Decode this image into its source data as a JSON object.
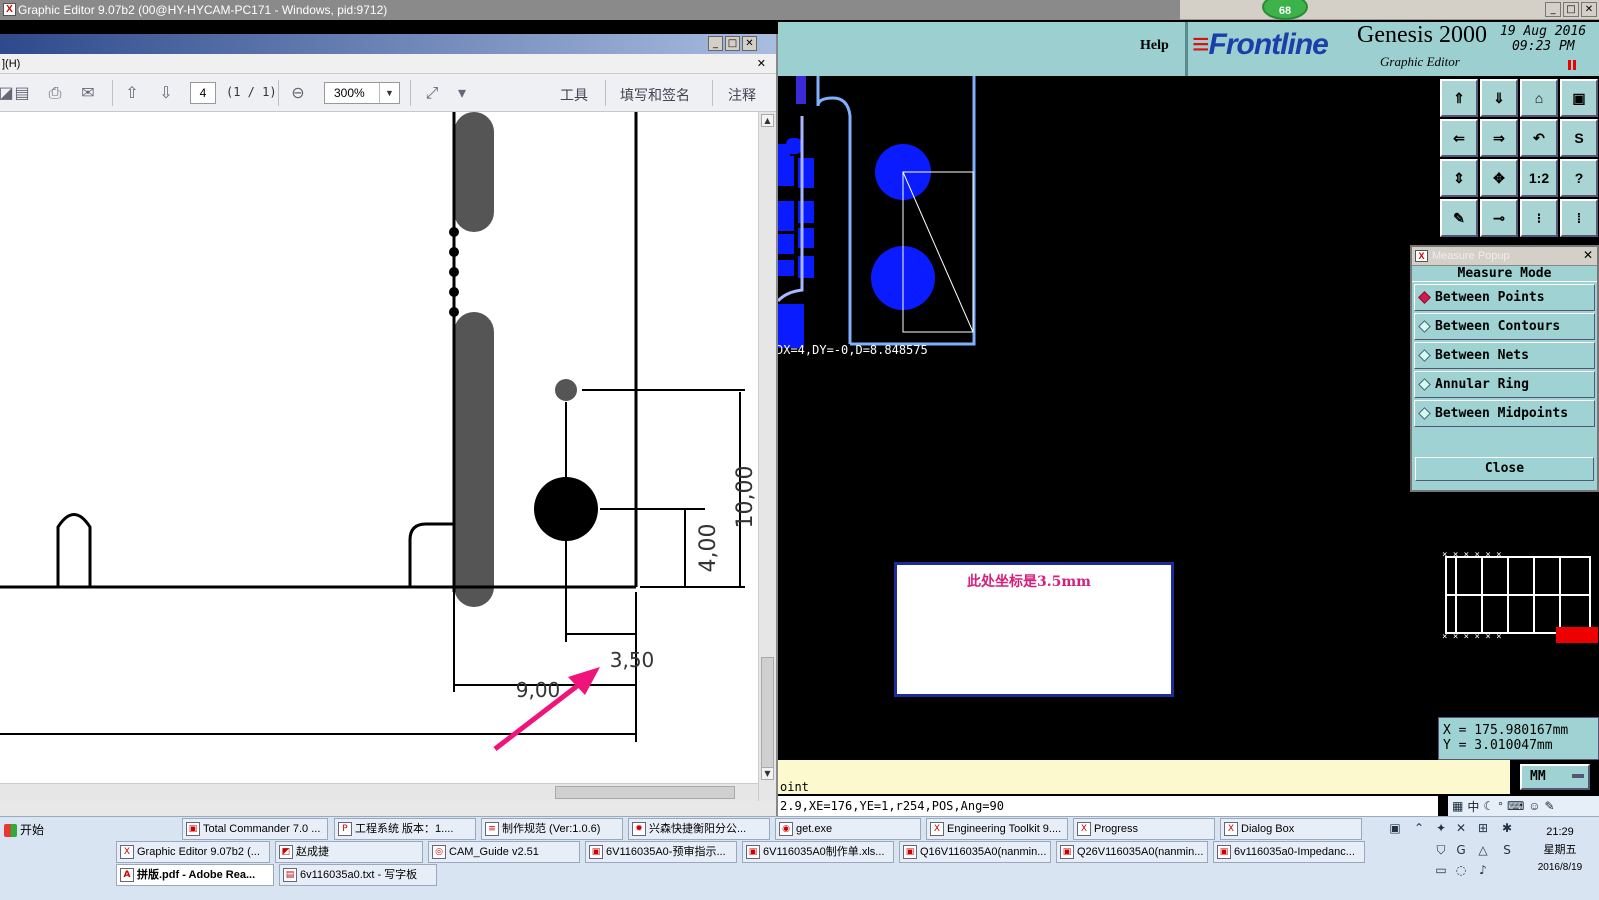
{
  "window": {
    "title": "Graphic Editor 9.07b2 (00@HY-HYCAM-PC171 - Windows, pid:9712)",
    "badge": "68",
    "min": "_",
    "max": "□",
    "close": "✕"
  },
  "genesis": {
    "help": "Help",
    "brand": "Frontline",
    "brand_stripes": "≡",
    "title": "Genesis 2000",
    "subtitle": "Graphic Editor",
    "date": "19 Aug 2016",
    "time": "09:23 PM",
    "canvas_readout": "DX=4,DY=-0,D=8.848575",
    "status_prompt": "oint",
    "status_info": "2.9,XE=176,YE=1,r254,POS,Ang=90",
    "unit": "MM",
    "coords": {
      "x": "X  =  175.980167mm",
      "y": "Y  =  3.010047mm"
    },
    "note_text": "此处坐标是3.5mm",
    "tool_buttons": [
      "⇑",
      "⇓",
      "⌂",
      "▣",
      "⇐",
      "⇒",
      "↶",
      "S",
      "⇕",
      "✥",
      "1:2",
      "?",
      "✎",
      "⊸",
      "⁝",
      "⁞"
    ]
  },
  "measure_popup": {
    "title": "Measure Popup",
    "close_x": "✕",
    "header": "Measure Mode",
    "options": [
      {
        "label": "Between Points",
        "selected": true
      },
      {
        "label": "Between Contours",
        "selected": false
      },
      {
        "label": "Between Nets",
        "selected": false
      },
      {
        "label": "Annular Ring",
        "selected": false
      },
      {
        "label": "Between Midpoints",
        "selected": false
      }
    ],
    "close_label": "Close"
  },
  "pdf": {
    "menu_item": "](H)",
    "close_x": "✕",
    "page_number": "4",
    "page_count": "(1 / 1)",
    "zoom": "300%",
    "link_tools": "工具",
    "link_sign": "填写和签名",
    "link_comment": "注释",
    "dimensions": {
      "d10": "10,00",
      "d4": "4,00",
      "d350": "3,50",
      "d9": "9,00"
    }
  },
  "taskbar": {
    "start": "开始",
    "row1": [
      "Total Commander 7.0 ...",
      "工程系统  版本：1....",
      "制作规范 (Ver:1.0.6)",
      "兴森快捷衡阳分公...",
      "get.exe",
      "Engineering Toolkit 9....",
      "Progress",
      "Dialog Box"
    ],
    "row2": [
      "Graphic Editor 9.07b2 (...",
      "赵成捷",
      "CAM_Guide v2.51",
      "6V116035A0-预审指示...",
      "6V116035A0制作单.xls...",
      "Q16V116035A0(nanmin...",
      "Q26V116035A0(nanmin...",
      "6v116035a0-Impedanc..."
    ],
    "row3": [
      "拼版.pdf - Adobe Rea...",
      "6v116035a0.txt - 写字板"
    ],
    "clock_time": "21:29",
    "clock_day": "星期五",
    "clock_date": "2016/8/19",
    "ime": "中"
  },
  "colors": {
    "genesis_panel": "#9fd2d2",
    "pad_blue": "#0a1cff",
    "note_border": "#1e2c9a",
    "arrow_pink": "#f0147a"
  }
}
